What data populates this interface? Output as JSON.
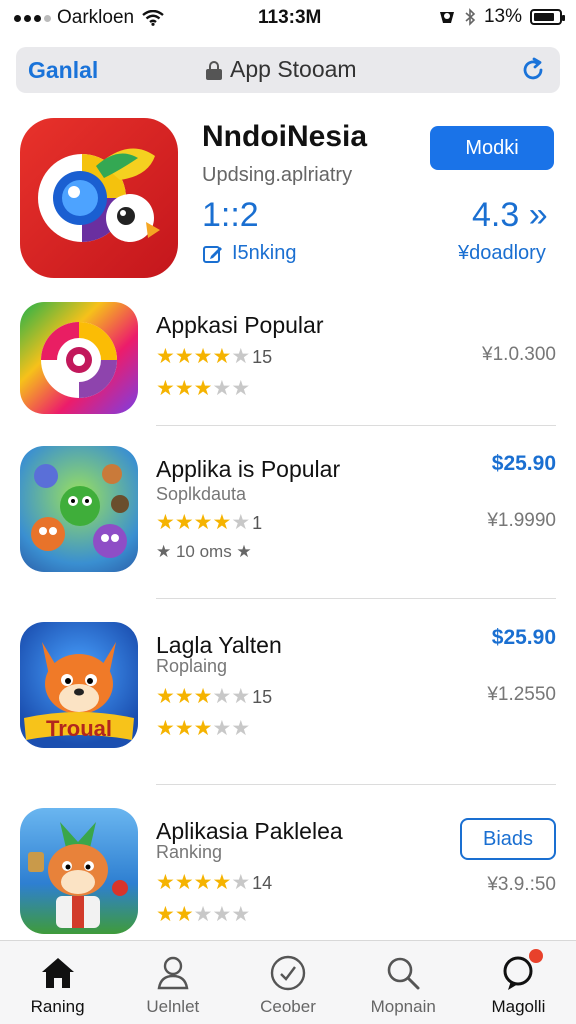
{
  "status_bar": {
    "carrier": "Oarkloen",
    "time": "113:3M",
    "battery_pct": "13%"
  },
  "url_bar": {
    "back_label": "Ganlal",
    "address": "App Stooam"
  },
  "featured": {
    "title": "NndoiNesia",
    "subtitle": "Updsing.aplriatry",
    "number": "1::2",
    "rank_label": "I5nking",
    "open_label": "Modki",
    "rating": "4.3 »",
    "category": "¥doadlory"
  },
  "apps": [
    {
      "title": "Appkasi Popular",
      "subtitle": "",
      "stars_1": 4.5,
      "count_1": "15",
      "stars_2": 3,
      "price_right": "¥1.0.300",
      "price_top": "",
      "extra": "",
      "button": ""
    },
    {
      "title": "Applika is Popular",
      "subtitle": "Soplkdauta",
      "stars_1": 4.5,
      "count_1": "1",
      "stars_2": 0,
      "price_right": "¥1.9990",
      "price_top": "$25.90",
      "extra": "★ 10 oms ★",
      "button": ""
    },
    {
      "title": "Lagla Yalten",
      "subtitle": "Roplaing",
      "stars_1": 3.5,
      "count_1": "15",
      "stars_2": 3,
      "price_right": "¥1.2550",
      "price_top": "$25.90",
      "extra": "",
      "button": ""
    },
    {
      "title": "Aplikasia Paklelea",
      "subtitle": "Ranking",
      "stars_1": 3.5,
      "count_1": "14",
      "stars_2": 2.5,
      "price_right": "¥3.9.:50",
      "price_top": "",
      "extra": "",
      "button": "Biads"
    }
  ],
  "tabs": [
    {
      "label": "Raning",
      "icon": "home-icon"
    },
    {
      "label": "Uelnlet",
      "icon": "person-icon"
    },
    {
      "label": "Ceober",
      "icon": "clock-icon"
    },
    {
      "label": "Mopnain",
      "icon": "search-icon"
    },
    {
      "label": "Magolli",
      "icon": "chat-icon"
    }
  ],
  "colors": {
    "accent": "#1a73e8",
    "star": "#f5b301",
    "badge": "#e8412b"
  }
}
